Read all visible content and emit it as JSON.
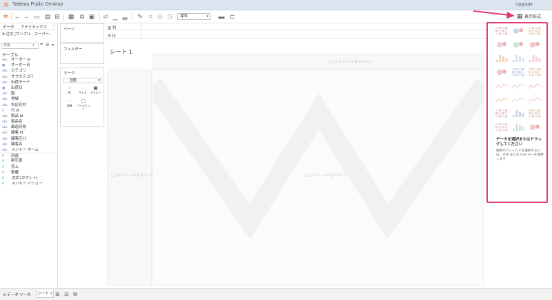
{
  "app": {
    "title": "Tableau Public Desktop",
    "upgrade": "Upgrade"
  },
  "toolbar": {
    "fit_select": "標準",
    "show_me_label": "表示形式",
    "icons": [
      "undo-icon",
      "redo-icon",
      "save-icon",
      "new-datasource-icon",
      "new-worksheet-icon",
      "swap-icon",
      "sort-ascending-icon",
      "sort-descending-icon",
      "highlight-icon",
      "group-icon",
      "label-icon",
      "fit-icon",
      "presentation-icon"
    ]
  },
  "data_pane": {
    "tab_data": "データ",
    "tab_analytics": "アナリティクス",
    "datasource": "注文 (サンプル - スーパー...",
    "search_placeholder": "検索",
    "section_table": "テーブル",
    "fields": [
      {
        "type": "Abc",
        "name": "オーダー Id",
        "kind": "dim"
      },
      {
        "type": "▣",
        "name": "オーダー日",
        "kind": "dim"
      },
      {
        "type": "Abc",
        "name": "カテゴリ",
        "kind": "dim"
      },
      {
        "type": "Abc",
        "name": "サブカテゴリ",
        "kind": "dim"
      },
      {
        "type": "Abc",
        "name": "出荷モード",
        "kind": "dim"
      },
      {
        "type": "▣",
        "name": "出荷日",
        "kind": "dim"
      },
      {
        "type": "Abc",
        "name": "国",
        "kind": "dim"
      },
      {
        "type": "Abc",
        "name": "地域",
        "kind": "dim"
      },
      {
        "type": "Abc",
        "name": "市区町村",
        "kind": "dim"
      },
      {
        "type": "#",
        "name": "行 Id",
        "kind": "dim"
      },
      {
        "type": "Abc",
        "name": "製品 Id",
        "kind": "dim"
      },
      {
        "type": "Abc",
        "name": "製品名",
        "kind": "dim"
      },
      {
        "type": "Abc",
        "name": "都道府県",
        "kind": "dim"
      },
      {
        "type": "Abc",
        "name": "顧客 Id",
        "kind": "dim"
      },
      {
        "type": "Abc",
        "name": "顧客区分",
        "kind": "dim"
      },
      {
        "type": "Abc",
        "name": "顧客名",
        "kind": "dim"
      },
      {
        "type": "Abc",
        "name": "メジャー ネーム",
        "kind": "dim-italic"
      },
      {
        "type": "#",
        "name": "利益",
        "kind": "measure"
      },
      {
        "type": "#",
        "name": "割引率",
        "kind": "measure"
      },
      {
        "type": "#",
        "name": "売上",
        "kind": "measure"
      },
      {
        "type": "#",
        "name": "数量",
        "kind": "measure"
      },
      {
        "type": "#",
        "name": "注文 (カウント)",
        "kind": "measure-italic"
      },
      {
        "type": "#",
        "name": "メジャー バリュー",
        "kind": "measure-italic"
      }
    ]
  },
  "shelves": {
    "pages": "ページ",
    "filters": "フィルター",
    "marks": "マーク",
    "marks_type": "自動",
    "mark_buttons": [
      {
        "icon": "color-icon",
        "label": "色"
      },
      {
        "icon": "size-icon",
        "label": "サイズ"
      },
      {
        "icon": "text-icon",
        "label": "テキスト"
      },
      {
        "icon": "detail-icon",
        "label": "詳細"
      },
      {
        "icon": "tooltip-icon",
        "label": "ツールヒント"
      }
    ],
    "columns": "列",
    "rows": "行"
  },
  "viz": {
    "sheet_title": "シート 1",
    "drop_top": "ここにフィールドをドロップ",
    "drop_left": "ここにフィールドをドロップ",
    "drop_main": "ここにフィールドをドロップ"
  },
  "show_me": {
    "message": "データを選択またはドラッグしてください",
    "hint": "複数のフィールドを選択するには、Shift または Cmd キーを使用します"
  },
  "bottom": {
    "datasource_tab": "データ ソース",
    "sheet_tab": "シート 1"
  },
  "colors": {
    "highlight": "#e23b74",
    "accent": "#e8762c"
  }
}
